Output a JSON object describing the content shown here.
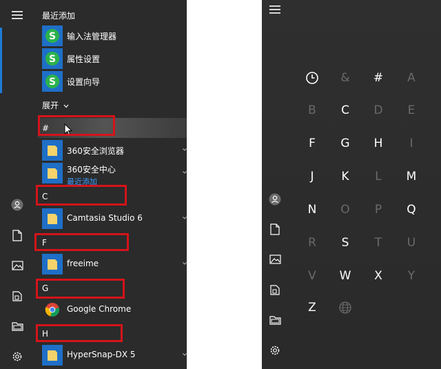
{
  "left_menu": {
    "recent_title": "最近添加",
    "recent_apps": [
      {
        "name": "输入法管理器"
      },
      {
        "name": "属性设置"
      },
      {
        "name": "设置向导"
      }
    ],
    "expand_label": "展开",
    "groups": [
      {
        "letter": "#",
        "apps": [
          {
            "name": "360安全浏览器"
          },
          {
            "name": "360安全中心",
            "sub": "最近添加"
          }
        ]
      },
      {
        "letter": "C",
        "apps": [
          {
            "name": "Camtasia Studio 6"
          }
        ]
      },
      {
        "letter": "F",
        "apps": [
          {
            "name": "freeime"
          }
        ]
      },
      {
        "letter": "G",
        "apps": [
          {
            "name": "Google Chrome"
          }
        ]
      },
      {
        "letter": "H",
        "apps": [
          {
            "name": "HyperSnap-DX 5"
          }
        ]
      }
    ]
  },
  "letter_grid": [
    {
      "label": "recent-clock",
      "enabled": true
    },
    {
      "label": "&",
      "enabled": false
    },
    {
      "label": "#",
      "enabled": true
    },
    {
      "label": "A",
      "enabled": false
    },
    {
      "label": "B",
      "enabled": false
    },
    {
      "label": "C",
      "enabled": true
    },
    {
      "label": "D",
      "enabled": false
    },
    {
      "label": "E",
      "enabled": false
    },
    {
      "label": "F",
      "enabled": true
    },
    {
      "label": "G",
      "enabled": true
    },
    {
      "label": "H",
      "enabled": true
    },
    {
      "label": "I",
      "enabled": false
    },
    {
      "label": "J",
      "enabled": true
    },
    {
      "label": "K",
      "enabled": true
    },
    {
      "label": "L",
      "enabled": false
    },
    {
      "label": "M",
      "enabled": true
    },
    {
      "label": "N",
      "enabled": true
    },
    {
      "label": "O",
      "enabled": false
    },
    {
      "label": "P",
      "enabled": false
    },
    {
      "label": "Q",
      "enabled": true
    },
    {
      "label": "R",
      "enabled": false
    },
    {
      "label": "S",
      "enabled": true
    },
    {
      "label": "T",
      "enabled": false
    },
    {
      "label": "U",
      "enabled": false
    },
    {
      "label": "V",
      "enabled": false
    },
    {
      "label": "W",
      "enabled": true
    },
    {
      "label": "X",
      "enabled": true
    },
    {
      "label": "Y",
      "enabled": false
    },
    {
      "label": "Z",
      "enabled": true
    },
    {
      "label": "globe",
      "enabled": false
    }
  ],
  "colors": {
    "accent": "#1e7bd6",
    "highlight_box": "#d4141a",
    "menu_bg": "#2b2b2b",
    "link_blue": "#3d9bff"
  },
  "icons": {
    "rail": [
      "hamburger-icon",
      "user-icon",
      "document-icon",
      "pictures-icon",
      "explorer-icon",
      "folder-icon",
      "gear-icon"
    ]
  }
}
